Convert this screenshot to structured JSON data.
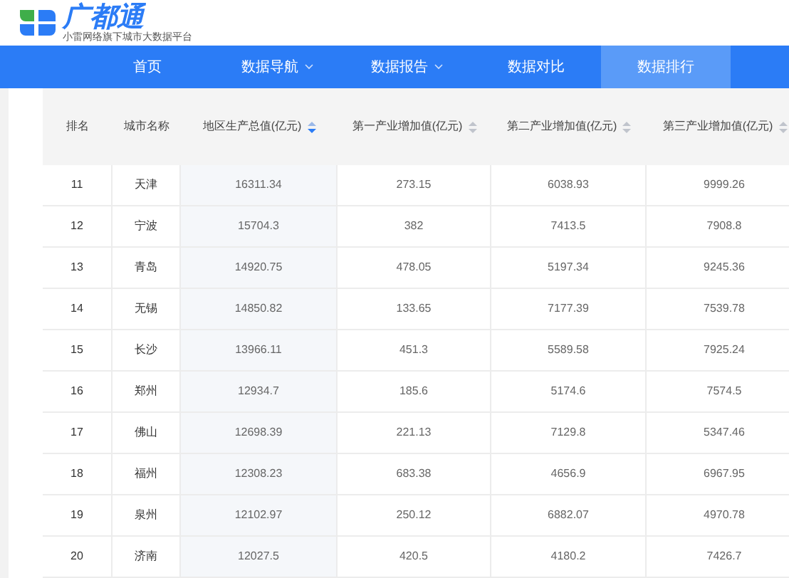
{
  "logo": {
    "title": "广都通",
    "subtitle": "小雷网络旗下城市大数据平台"
  },
  "nav": [
    {
      "label": "首页",
      "dropdown": false,
      "selected": false
    },
    {
      "label": "数据导航",
      "dropdown": true,
      "selected": false
    },
    {
      "label": "数据报告",
      "dropdown": true,
      "selected": false
    },
    {
      "label": "数据对比",
      "dropdown": false,
      "selected": false
    },
    {
      "label": "数据排行",
      "dropdown": false,
      "selected": true
    }
  ],
  "table": {
    "columns": [
      {
        "label": "排名",
        "sortable": false
      },
      {
        "label": "城市名称",
        "sortable": false
      },
      {
        "label": "地区生产总值(亿元)",
        "sortable": true,
        "sorted": true
      },
      {
        "label": "第一产业增加值(亿元)",
        "sortable": true,
        "sorted": false
      },
      {
        "label": "第二产业增加值(亿元)",
        "sortable": true,
        "sorted": false
      },
      {
        "label": "第三产业增加值(亿元)",
        "sortable": true,
        "sorted": false
      }
    ],
    "rows": [
      [
        "11",
        "天津",
        "16311.34",
        "273.15",
        "6038.93",
        "9999.26"
      ],
      [
        "12",
        "宁波",
        "15704.3",
        "382",
        "7413.5",
        "7908.8"
      ],
      [
        "13",
        "青岛",
        "14920.75",
        "478.05",
        "5197.34",
        "9245.36"
      ],
      [
        "14",
        "无锡",
        "14850.82",
        "133.65",
        "7177.39",
        "7539.78"
      ],
      [
        "15",
        "长沙",
        "13966.11",
        "451.3",
        "5589.58",
        "7925.24"
      ],
      [
        "16",
        "郑州",
        "12934.7",
        "185.6",
        "5174.6",
        "7574.5"
      ],
      [
        "17",
        "佛山",
        "12698.39",
        "221.13",
        "7129.8",
        "5347.46"
      ],
      [
        "18",
        "福州",
        "12308.23",
        "683.38",
        "4656.9",
        "6967.95"
      ],
      [
        "19",
        "泉州",
        "12102.97",
        "250.12",
        "6882.07",
        "4970.78"
      ],
      [
        "20",
        "济南",
        "12027.5",
        "420.5",
        "4180.2",
        "7426.7"
      ]
    ]
  }
}
